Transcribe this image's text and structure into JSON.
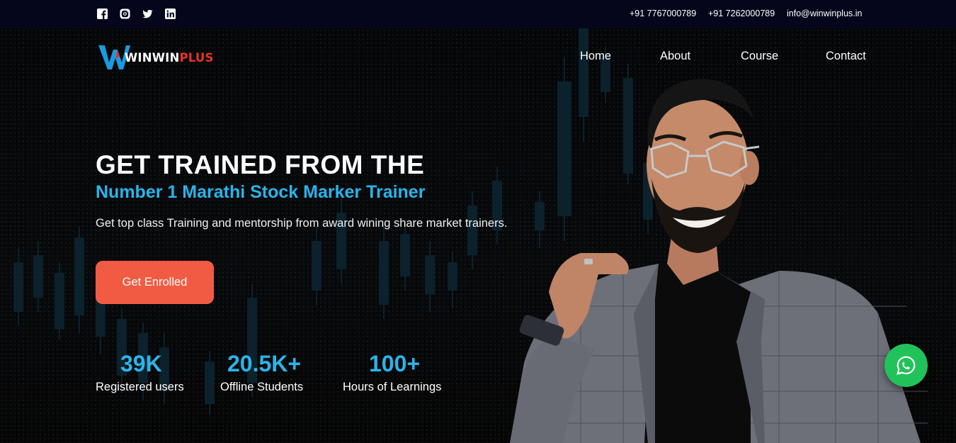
{
  "topbar": {
    "social": [
      {
        "icon": "facebook-icon"
      },
      {
        "icon": "instagram-icon"
      },
      {
        "icon": "twitter-icon"
      },
      {
        "icon": "linkedin-icon"
      }
    ],
    "phone1": "+91 7767000789",
    "phone2": "+91 7262000789",
    "email": "info@winwinplus.in"
  },
  "logo": {
    "part1": "WINWIN",
    "part2": "PLUS",
    "colors": {
      "mark": "#1a9be0",
      "accent": "#e8322a"
    }
  },
  "nav": [
    "Home",
    "About",
    "Course",
    "Contact"
  ],
  "hero": {
    "title": "GET TRAINED FROM THE",
    "subtitle": "Number 1 Marathi Stock Marker Trainer",
    "lead": "Get top class Training and mentorship from award wining share market trainers.",
    "cta_label": "Get Enrolled"
  },
  "stats": [
    {
      "value": "39K",
      "label": "Registered users"
    },
    {
      "value": "20.5K+",
      "label": "Offline Students"
    },
    {
      "value": "100+",
      "label": "Hours of Learnings"
    }
  ],
  "colors": {
    "accent_blue": "#2ab4ea",
    "cta": "#f15b43",
    "whatsapp": "#22c25a",
    "topbar_bg": "#05051c"
  },
  "whatsapp": {
    "icon": "whatsapp-icon"
  }
}
